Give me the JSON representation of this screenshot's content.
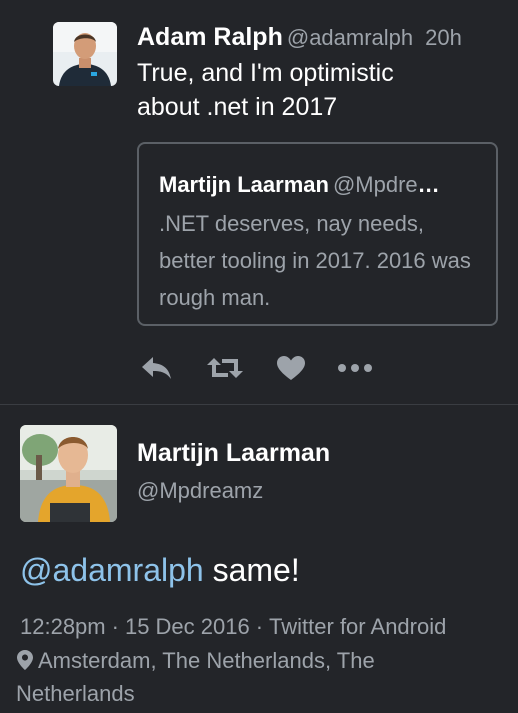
{
  "reply_tweet": {
    "author_name": "Adam Ralph",
    "author_handle": "@adamralph",
    "time": "20h",
    "text": "True, and I'm optimistic about .net in 2017",
    "quoted_tweet": {
      "author_name": "Martijn Laarman",
      "author_handle": "@Mpdre",
      "ellipsis": "…",
      "text": ".NET deserves, nay needs, better tooling in 2017. 2016 was rough man."
    },
    "actions": [
      {
        "name": "reply",
        "icon": "reply-icon"
      },
      {
        "name": "retweet",
        "icon": "retweet-icon"
      },
      {
        "name": "like",
        "icon": "heart-icon"
      },
      {
        "name": "more",
        "icon": "more-icon"
      }
    ]
  },
  "main_tweet": {
    "author_name": "Martijn Laarman",
    "author_handle": "@Mpdreamz",
    "mention": "@adamralph",
    "text": " same!",
    "time": "12:28pm",
    "separator": "·",
    "date": "15 Dec 2016",
    "source": "Twitter for Android",
    "location": "Amsterdam, The Netherlands, The Netherlands"
  },
  "colors": {
    "background": "#232529",
    "primary_text": "#ffffff",
    "secondary_text": "#9da3aa",
    "mention": "#8ec3ea",
    "icon": "#9da3aa",
    "border": "#5b6066"
  }
}
